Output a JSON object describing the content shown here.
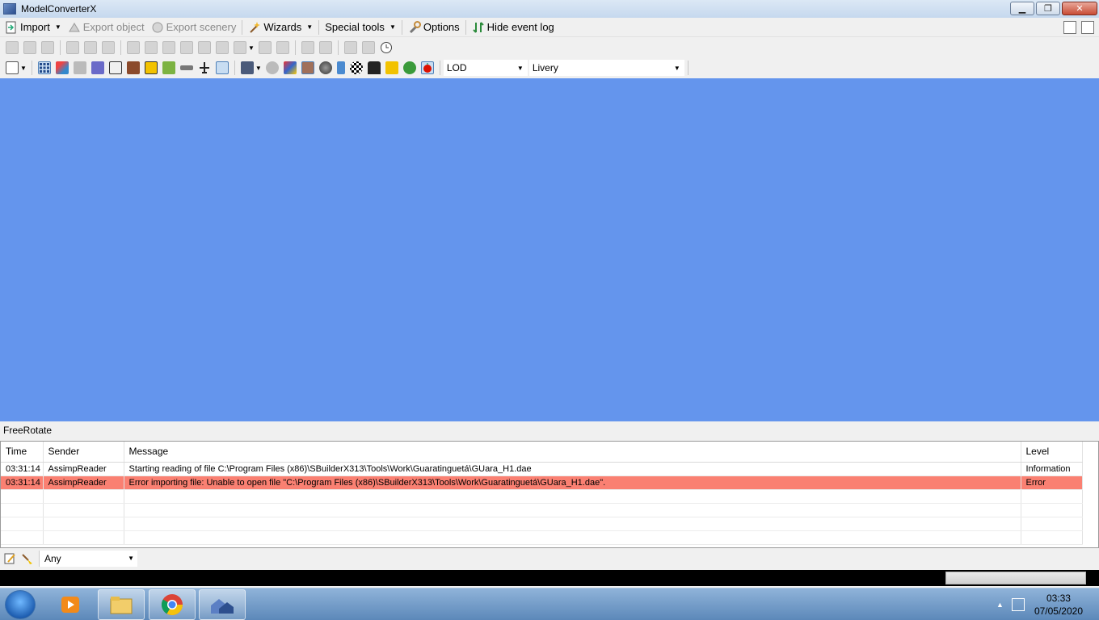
{
  "window": {
    "title": "ModelConverterX"
  },
  "titlebar_buttons": {
    "minimize": "▁",
    "restore": "❐",
    "close": "✕"
  },
  "menu": {
    "import": "Import",
    "export_object": "Export object",
    "export_scenery": "Export scenery",
    "wizards": "Wizards",
    "special_tools": "Special tools",
    "options": "Options",
    "hide_event_log": "Hide event log"
  },
  "toolbar2": {
    "lod_label": "LOD",
    "lod_value": "",
    "livery_label": "Livery",
    "livery_value": ""
  },
  "viewport": {
    "background": "#6495ed"
  },
  "panel": {
    "title": "FreeRotate"
  },
  "log": {
    "columns": {
      "time": "Time",
      "sender": "Sender",
      "message": "Message",
      "level": "Level"
    },
    "rows": [
      {
        "time": "03:31:14",
        "sender": "AssimpReader",
        "message": "Starting reading of file C:\\Program Files (x86)\\SBuilderX313\\Tools\\Work\\Guaratinguetá\\GUara_H1.dae",
        "level": "Information"
      },
      {
        "time": "03:31:14",
        "sender": "AssimpReader",
        "message": "Error importing file: Unable to open file \"C:\\Program Files (x86)\\SBuilderX313\\Tools\\Work\\Guaratinguetá\\GUara_H1.dae\".",
        "level": "Error"
      }
    ],
    "error_color": "#fa8072"
  },
  "filter": {
    "value": "Any"
  },
  "taskbar": {
    "time": "03:33",
    "date": "07/05/2020"
  }
}
